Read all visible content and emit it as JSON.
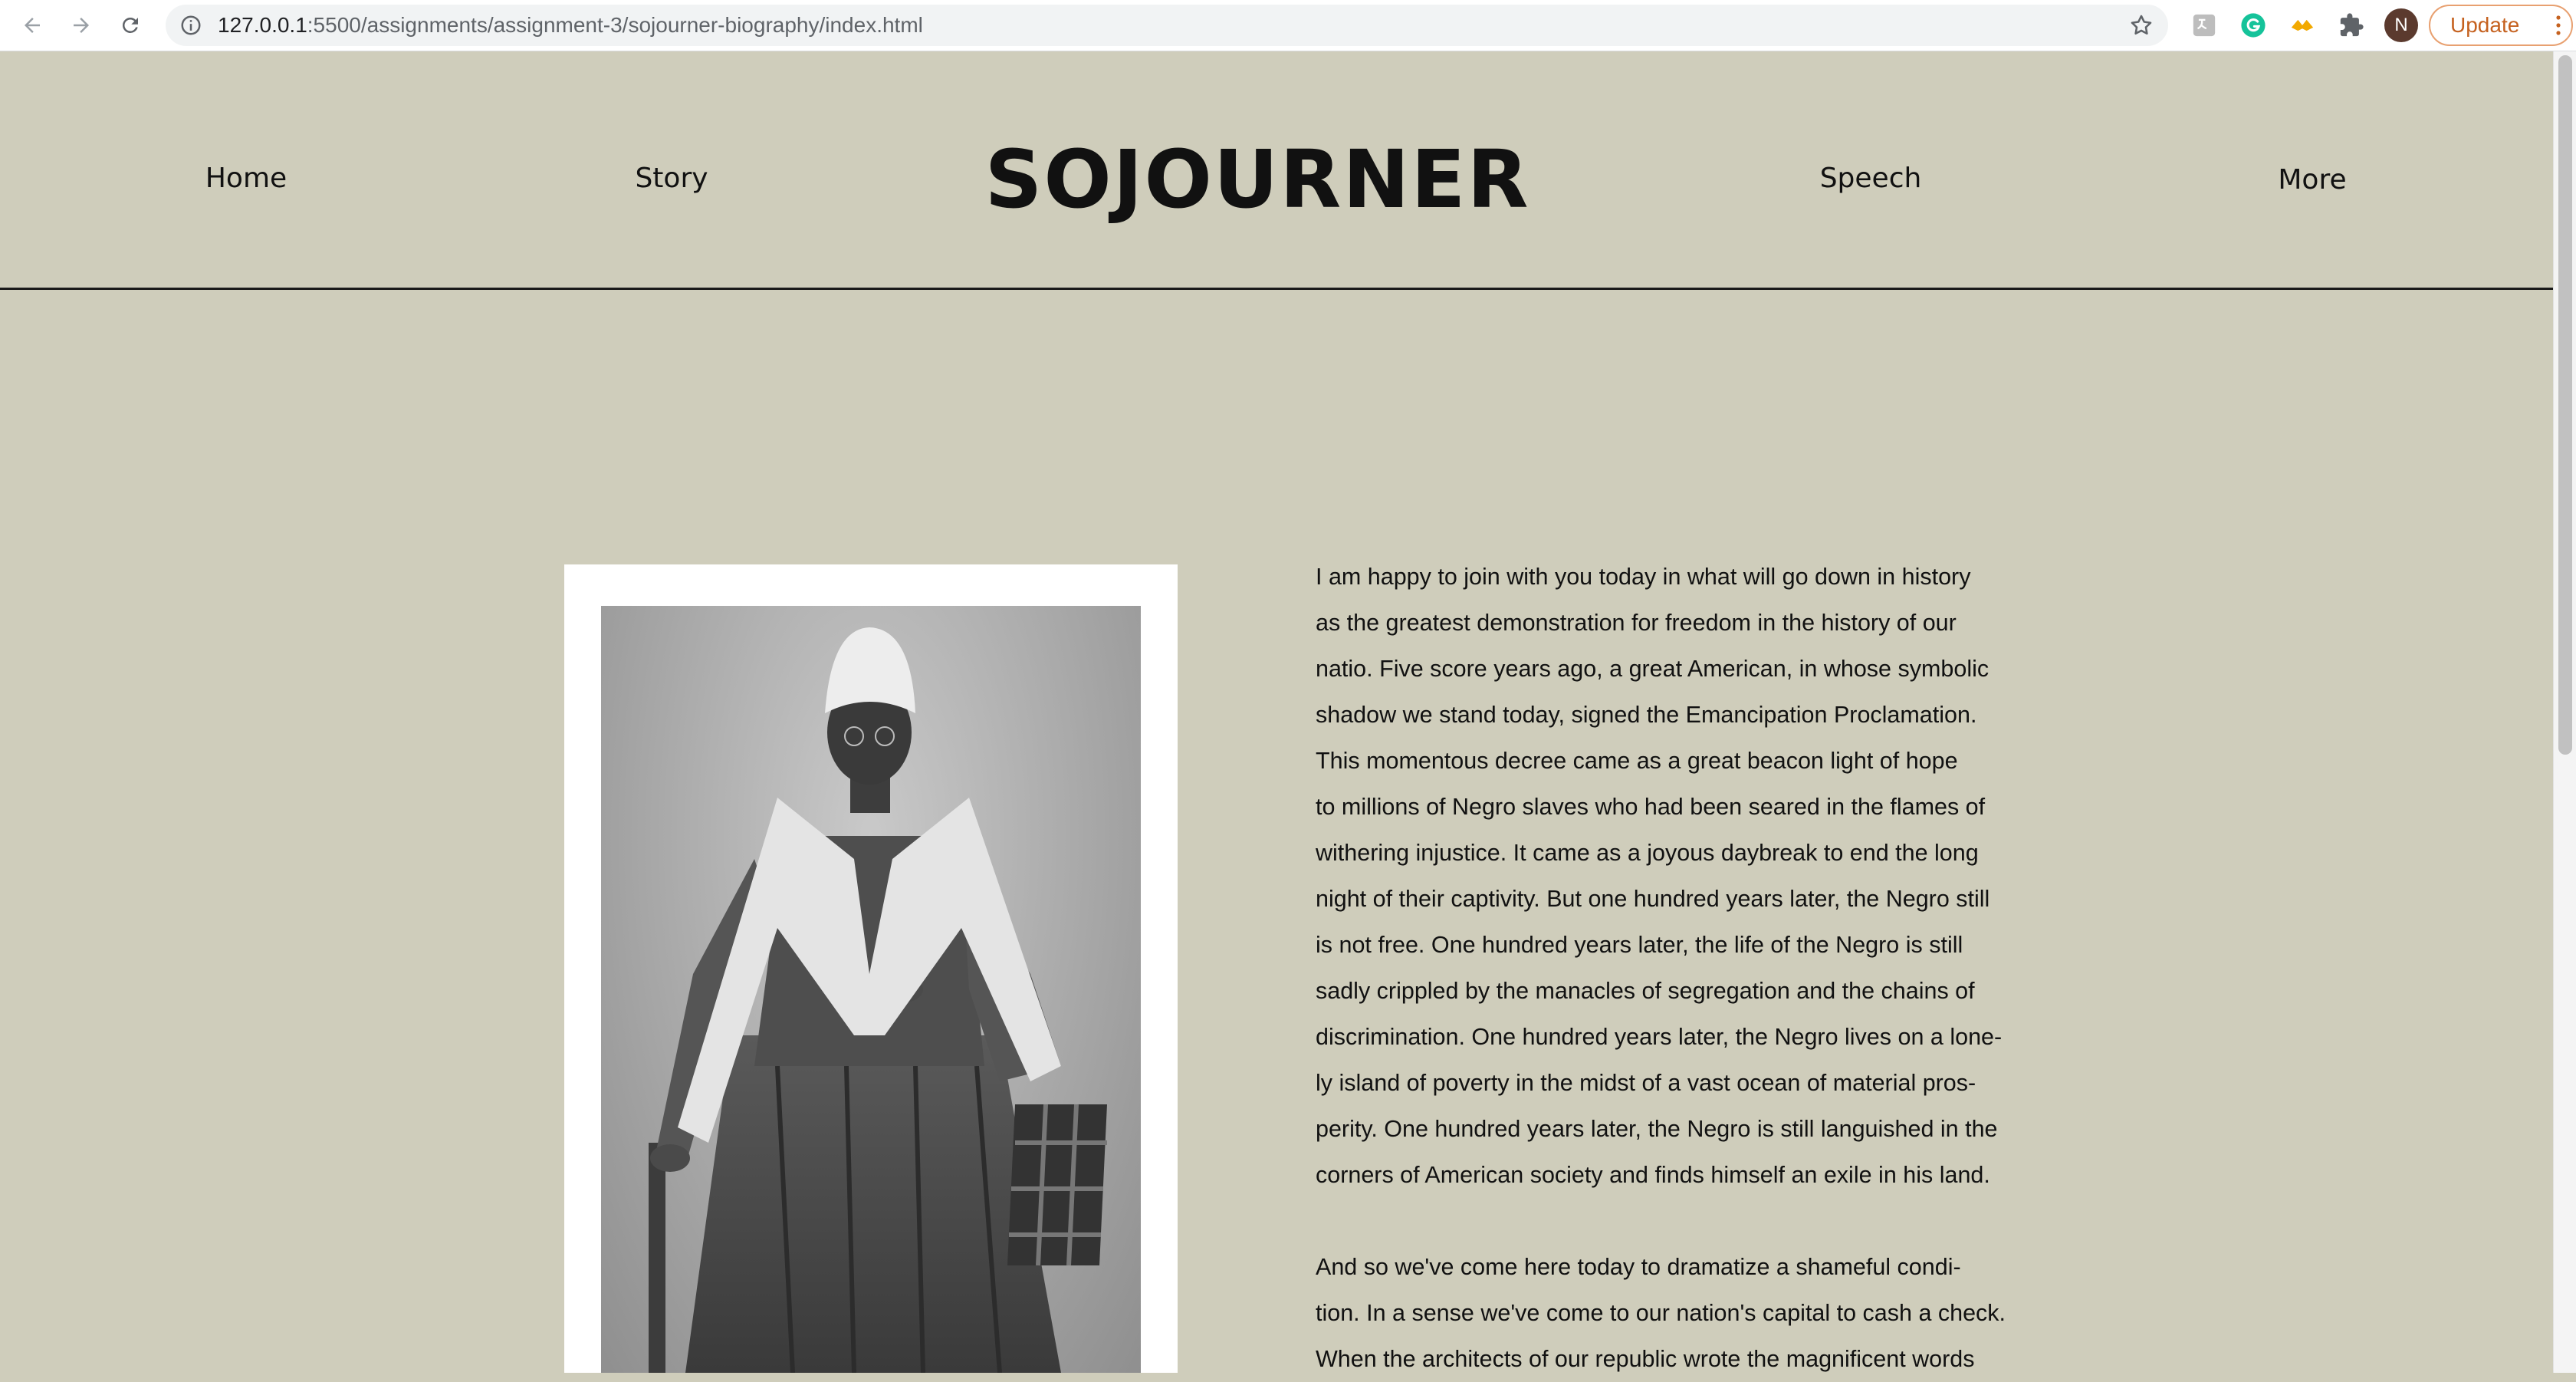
{
  "browser": {
    "url_host": "127.0.0.1",
    "url_path": ":5500/assignments/assignment-3/sojourner-biography/index.html",
    "avatar_letter": "N",
    "update_label": "Update"
  },
  "site": {
    "brand": "SOJOURNER",
    "nav": {
      "home": "Home",
      "story": "Story",
      "speech": "Speech",
      "more": "More"
    }
  },
  "speech": {
    "paragraphs": [
      {
        "lines": [
          "I am happy to join with you today in what will go down in history",
          "as the greatest demonstration for freedom in the history of our",
          "natio. Five score years ago, a great American, in whose symbolic",
          "shadow we stand today, signed the Emancipation Proclamation.",
          "This momentous decree came as a great beacon light of hope",
          "to millions of Negro slaves who had been seared in the flames of",
          "withering injustice. It came as a joyous daybreak to end the long",
          "night of their captivity. But one hundred years later, the Negro still",
          "is not free. One hundred years later, the life of the Negro is still",
          "sadly crippled by the manacles of segregation and the chains of",
          "discrimination. One hundred years later, the Negro lives on a lone-",
          "ly island of poverty in the midst of a vast ocean of material pros-",
          "perity. One hundred years later, the Negro is still languished in the",
          "corners of American society and finds himself an exile in his land."
        ]
      },
      {
        "lines": [
          "And so we've come here today to dramatize a shameful condi-",
          "tion. In a sense we've come to our nation's capital to cash a check.",
          "When the architects of our republic wrote the magnificent words"
        ]
      }
    ]
  },
  "colors": {
    "page_background": "#cfcdbb",
    "text": "#111111",
    "rule": "#1a1a1a",
    "update_accent": "#c5611f"
  },
  "icons": {
    "back": "arrow-left-icon",
    "forward": "arrow-right-icon",
    "reload": "reload-icon",
    "site_info": "info-circle-icon",
    "bookmark": "star-icon",
    "extensions": [
      "translate-icon",
      "grammarly-icon",
      "bird-icon",
      "puzzle-icon"
    ],
    "menu": "kebab-menu-icon"
  }
}
